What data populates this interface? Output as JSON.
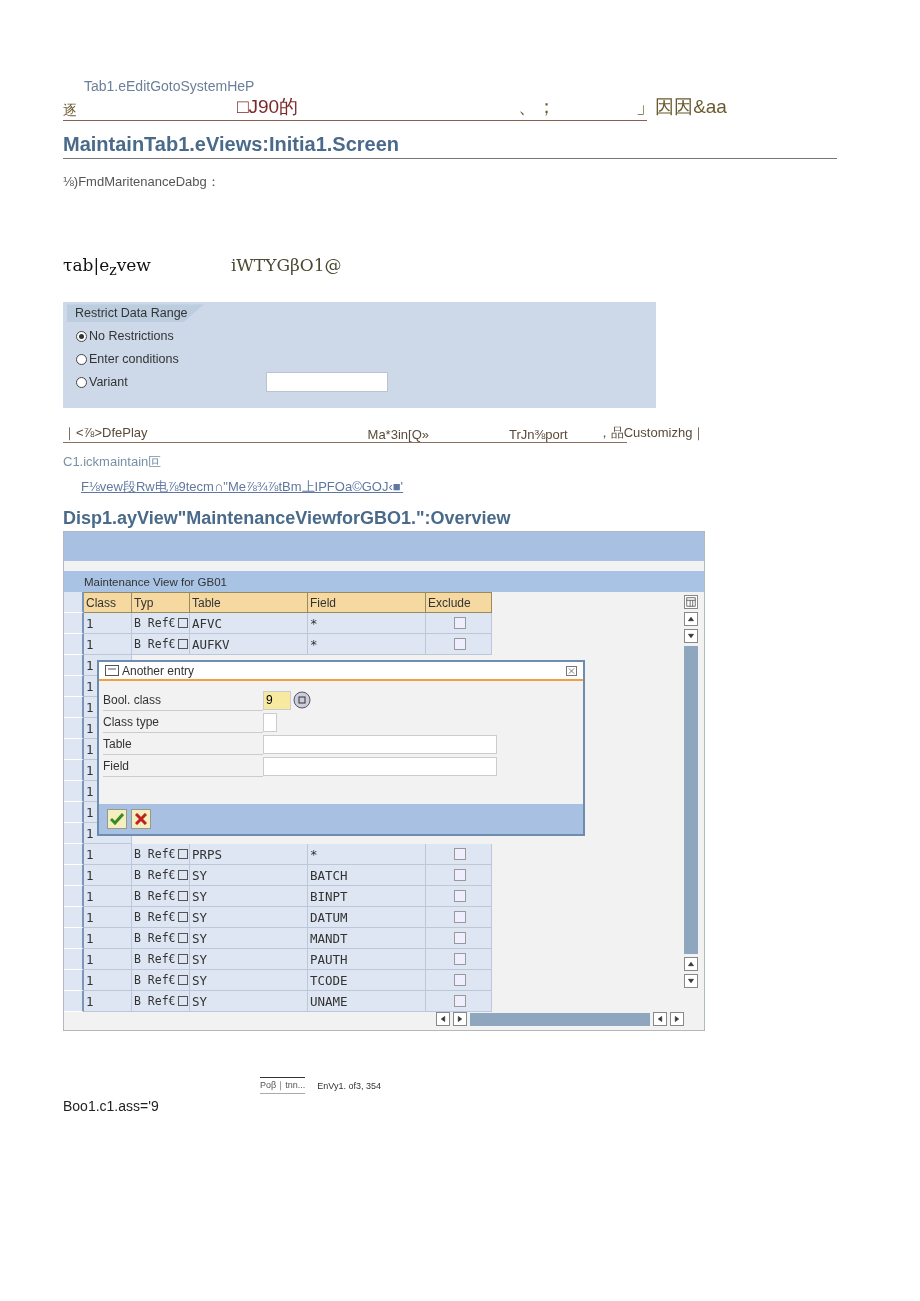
{
  "menu_line": "Tab1.eEditGotoSystemHeP",
  "toolbar_fragments": [
    "逐",
    "□J90的",
    "、；",
    "」因因&aa"
  ],
  "title": "MaintainTab1.eViews:Initia1.Screen",
  "subtitle": "⅛)FmdMaritenanceDabg：",
  "view_label": "τab|e$_{z}$vew",
  "view_value": "iWTYGβO1@",
  "restrict": {
    "title": "Restrict Data Range",
    "options": [
      {
        "label": "No Restrictions",
        "selected": true
      },
      {
        "label": "Enter conditions",
        "selected": false
      },
      {
        "label": "Variant",
        "selected": false
      }
    ]
  },
  "actions": [
    "｜<⅞>DfePlay",
    "Ma*3in[Q»",
    "TrJn⅜port",
    "，品Customizhg｜"
  ],
  "instruction": "C1.ickmaintain叵",
  "instruction_link": "F⅛vew段Rw电⅞9tecm∩\"Me⅞¾⅞tBm上IPFOa©GOJ‹■'",
  "overview_title": "Disp1.ayView\"MaintenanceViewforGBO1.\":Overview",
  "sap_window": {
    "panel_title": "Maintenance View for GB01",
    "columns": [
      "Class",
      "Typ",
      "Table",
      "Field",
      "Exclude"
    ],
    "rows": [
      {
        "class": "1",
        "typ": "B Ref€",
        "table": "AFVC",
        "field": "*",
        "exclude": false
      },
      {
        "class": "1",
        "typ": "B Ref€",
        "table": "AUFKV",
        "field": "*",
        "exclude": false
      },
      {
        "class": "1"
      },
      {
        "class": "1"
      },
      {
        "class": "1"
      },
      {
        "class": "1"
      },
      {
        "class": "1"
      },
      {
        "class": "1"
      },
      {
        "class": "1"
      },
      {
        "class": "1"
      },
      {
        "class": "1"
      },
      {
        "class": "1",
        "typ": "B Ref€",
        "table": "PRPS",
        "field": "*",
        "exclude": false
      },
      {
        "class": "1",
        "typ": "B Ref€",
        "table": "SY",
        "field": "BATCH",
        "exclude": false
      },
      {
        "class": "1",
        "typ": "B Ref€",
        "table": "SY",
        "field": "BINPT",
        "exclude": false
      },
      {
        "class": "1",
        "typ": "B Ref€",
        "table": "SY",
        "field": "DATUM",
        "exclude": false
      },
      {
        "class": "1",
        "typ": "B Ref€",
        "table": "SY",
        "field": "MANDT",
        "exclude": false
      },
      {
        "class": "1",
        "typ": "B Ref€",
        "table": "SY",
        "field": "PAUTH",
        "exclude": false
      },
      {
        "class": "1",
        "typ": "B Ref€",
        "table": "SY",
        "field": "TCODE",
        "exclude": false
      },
      {
        "class": "1",
        "typ": "B Ref€",
        "table": "SY",
        "field": "UNAME",
        "exclude": false
      }
    ],
    "dialog": {
      "title": "Another entry",
      "fields": [
        {
          "kind": "short",
          "label": "Bool. class",
          "value": "9",
          "focused": true
        },
        {
          "kind": "tiny",
          "label": "Class type",
          "focused": false
        },
        {
          "kind": "wide",
          "label": "Table",
          "focused": false
        },
        {
          "kind": "wide",
          "label": "Field",
          "focused": false
        }
      ]
    }
  },
  "status": {
    "fragment": "Poβ｜tnn...",
    "entry": "EnVy1. of3, 354"
  },
  "footer": "Boo1.c1.ass='9"
}
